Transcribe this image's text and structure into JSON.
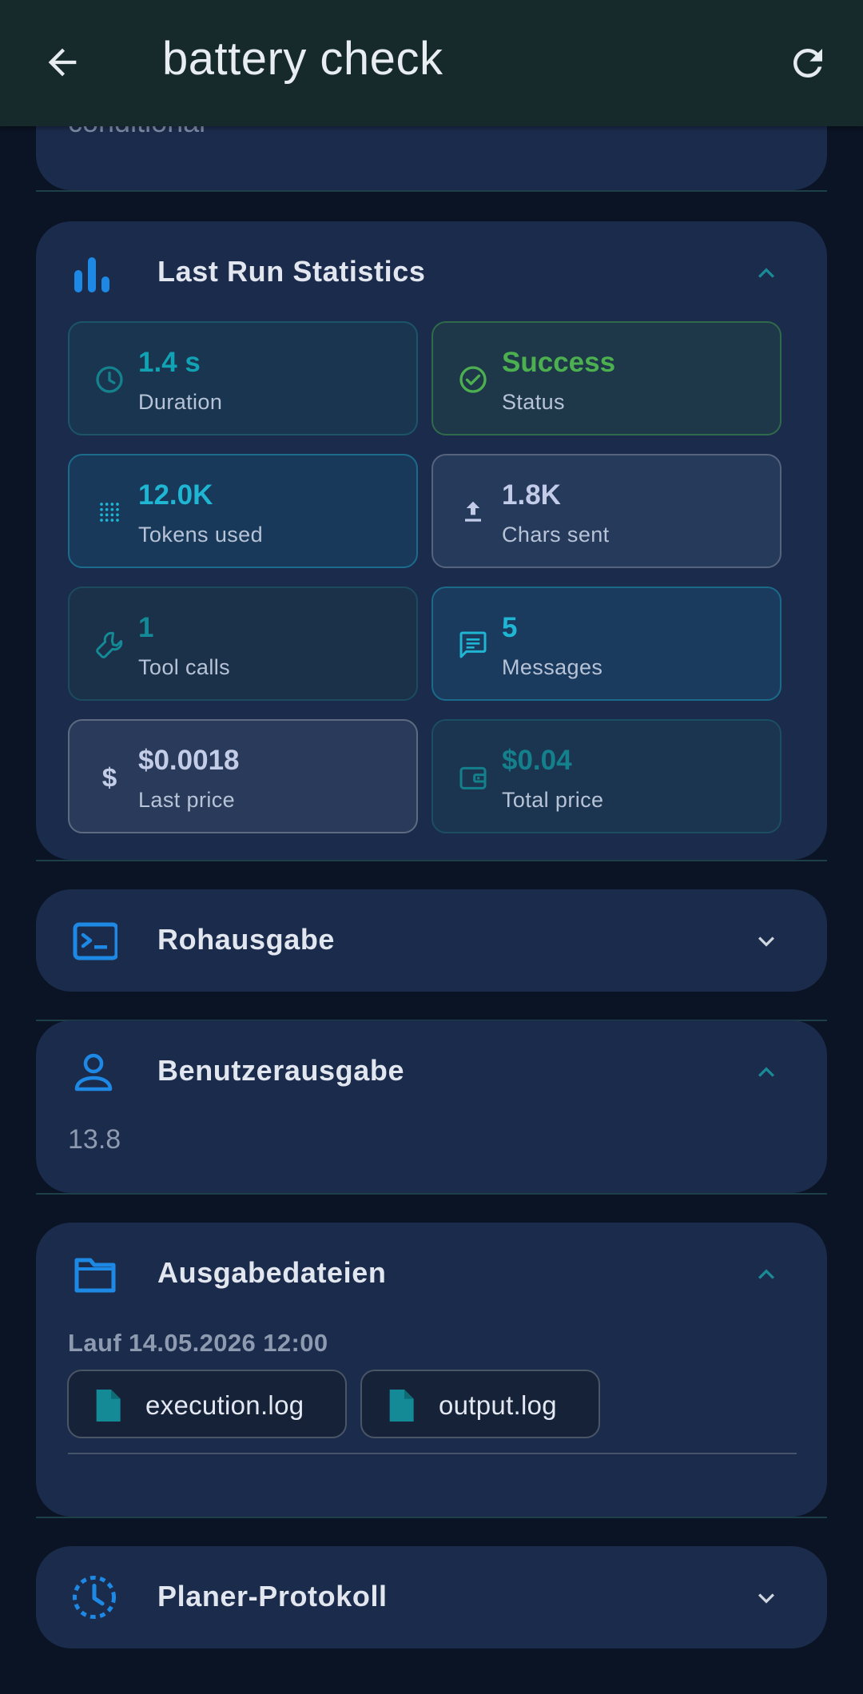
{
  "app_bar": {
    "title": "battery check",
    "back_icon": "arrow-left-icon",
    "refresh_icon": "refresh-icon"
  },
  "top_card": {
    "partial_text": "conditional"
  },
  "last_run": {
    "title": "Last Run Statistics",
    "icon": "bar-chart-icon",
    "stats": [
      {
        "value": "1.4 s",
        "label": "Duration",
        "icon": "clock-icon",
        "value_color": "#11a2b3"
      },
      {
        "value": "Success",
        "label": "Status",
        "icon": "check-circle-icon",
        "value_color": "#4caf50"
      },
      {
        "value": "12.0K",
        "label": "Tokens used",
        "icon": "token-grid-icon",
        "value_color": "#1fb6d4"
      },
      {
        "value": "1.8K",
        "label": "Chars sent",
        "icon": "upload-icon",
        "value_color": "#c2cbe8"
      },
      {
        "value": "1",
        "label": "Tool calls",
        "icon": "wrench-icon",
        "value_color": "#138a96"
      },
      {
        "value": "5",
        "label": "Messages",
        "icon": "message-icon",
        "value_color": "#20b5d3"
      },
      {
        "value": "$0.0018",
        "label": "Last price",
        "icon": "dollar-icon",
        "value_color": "#c4cde8"
      },
      {
        "value": "$0.04",
        "label": "Total price",
        "icon": "wallet-icon",
        "value_color": "#14808c"
      }
    ]
  },
  "raw_output": {
    "title": "Rohausgabe",
    "icon": "terminal-icon"
  },
  "user_output": {
    "title": "Benutzerausgabe",
    "icon": "person-icon",
    "value": "13.8"
  },
  "output_files": {
    "title": "Ausgabedateien",
    "icon": "folder-icon",
    "run_label": "Lauf 14.05.2026 12:00",
    "files": [
      {
        "name": "execution.log",
        "icon": "file-icon"
      },
      {
        "name": "output.log",
        "icon": "file-icon"
      }
    ]
  },
  "scheduler_log": {
    "title": "Planer-Protokoll",
    "icon": "clock-dashed-icon"
  },
  "colors": {
    "accent_teal": "#1a8a96",
    "accent_blue": "#1e88e5",
    "card_bg": "#1b2b4b",
    "page_bg": "#0b1424",
    "appbar_bg": "#172a2b"
  }
}
